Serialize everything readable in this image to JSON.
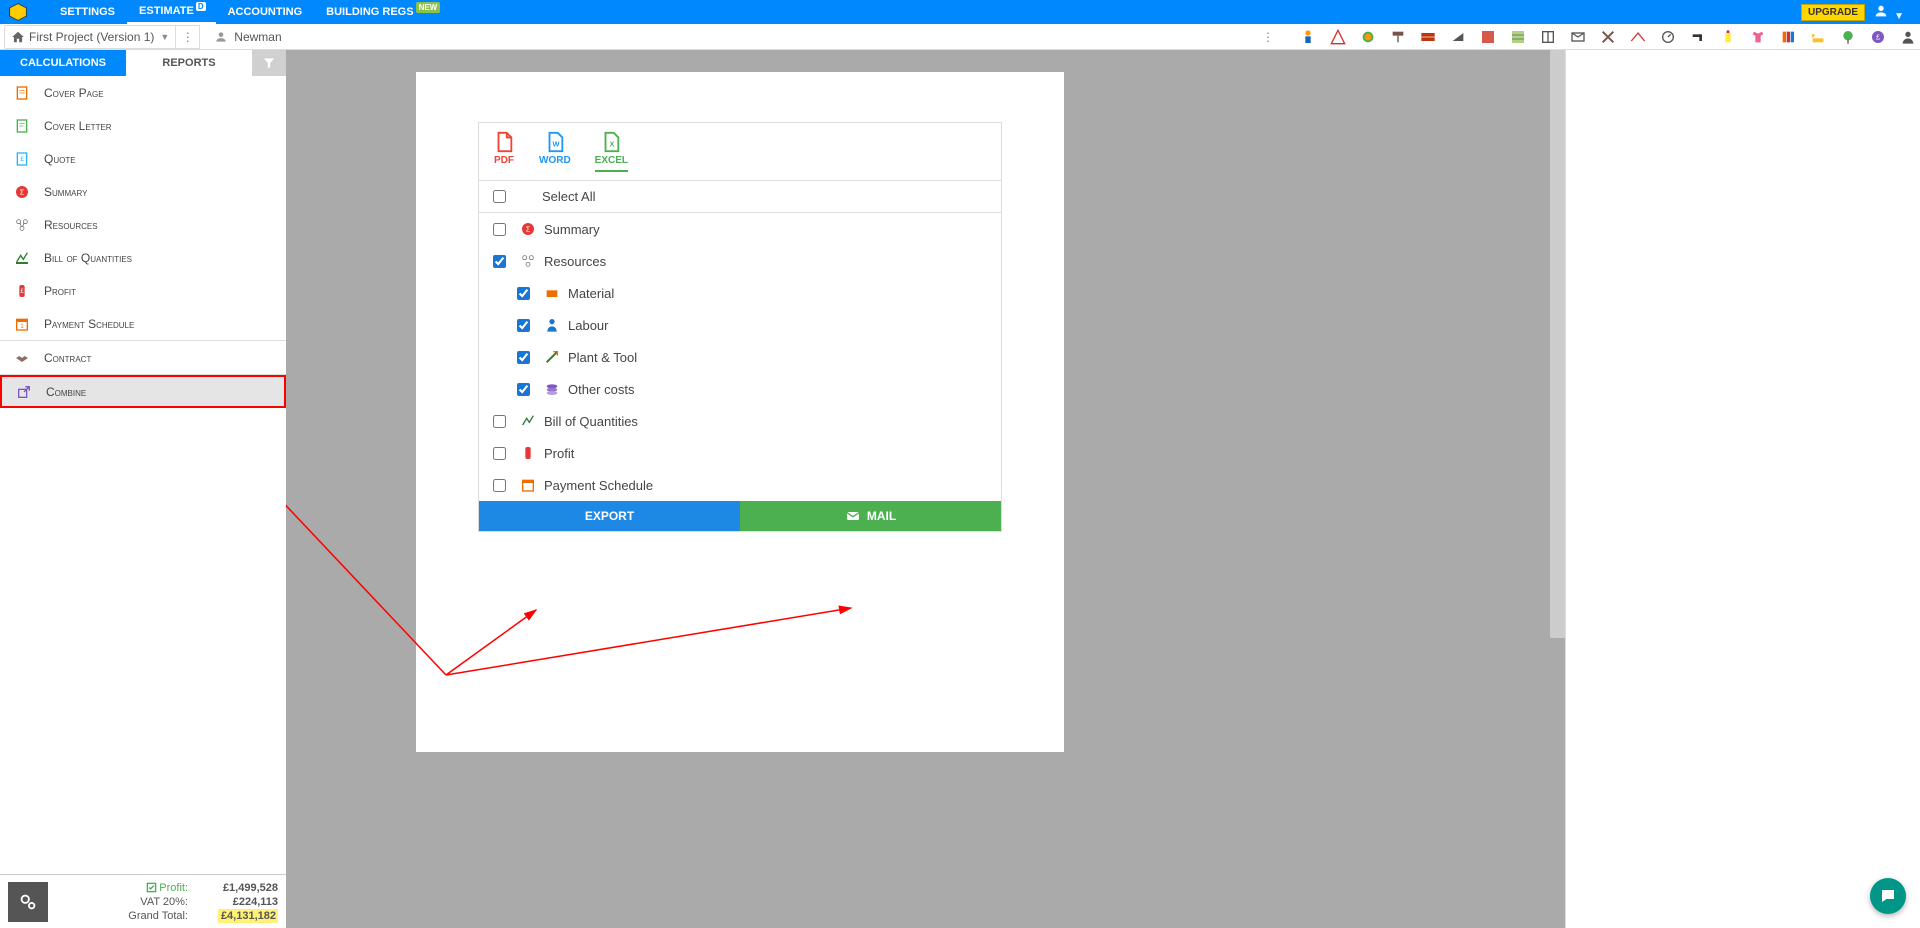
{
  "topNav": {
    "settings": "SETTINGS",
    "estimate": "ESTIMATE",
    "estimateBadge": "D",
    "accounting": "ACCOUNTING",
    "buildingRegs": "BUILDING REGS",
    "newBadge": "NEW",
    "upgrade": "UPGRADE"
  },
  "secondBar": {
    "project": "First Project (Version 1)",
    "user": "Newman"
  },
  "sidebarTabs": {
    "calculations": "CALCULATIONS",
    "reports": "REPORTS"
  },
  "sidebarItems": {
    "coverPage": "Cover Page",
    "coverLetter": "Cover Letter",
    "quote": "Quote",
    "summary": "Summary",
    "resources": "Resources",
    "boq": "Bill of Quantities",
    "profit": "Profit",
    "paymentSchedule": "Payment Schedule",
    "contract": "Contract",
    "combine": "Combine"
  },
  "footer": {
    "profitLabel": "Profit:",
    "profitVal": "£1,499,528",
    "vatLabel": "VAT 20%:",
    "vatVal": "£224,113",
    "grandLabel": "Grand Total:",
    "grandVal": "£4,131,182"
  },
  "formats": {
    "pdf": "PDF",
    "word": "WORD",
    "excel": "EXCEL"
  },
  "panel": {
    "selectAll": "Select All",
    "summary": "Summary",
    "resources": "Resources",
    "material": "Material",
    "labour": "Labour",
    "plantTool": "Plant & Tool",
    "otherCosts": "Other costs",
    "boq": "Bill of Quantities",
    "profit": "Profit",
    "paymentSchedule": "Payment Schedule",
    "export": "EXPORT",
    "mail": "MAIL"
  }
}
